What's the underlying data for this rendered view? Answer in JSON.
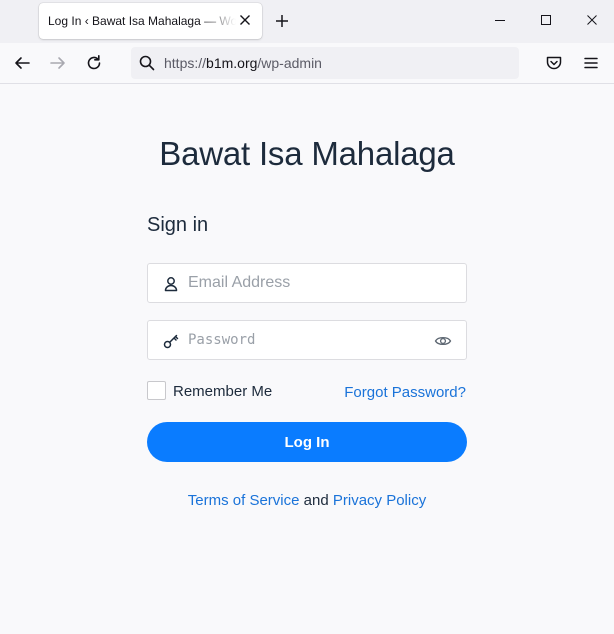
{
  "browser": {
    "tab_title": "Log In ‹ Bawat Isa Mahalaga — WordPress",
    "url_scheme": "https://",
    "url_host": "b1m.org",
    "url_path": "/wp-admin"
  },
  "page": {
    "site_title": "Bawat Isa Mahalaga",
    "heading": "Sign in",
    "email_placeholder": "Email Address",
    "password_placeholder": "Password",
    "remember_label": "Remember Me",
    "forgot_label": "Forgot Password?",
    "login_label": "Log In",
    "terms_label": "Terms of Service",
    "and_text": "and",
    "privacy_label": "Privacy Policy"
  },
  "colors": {
    "accent": "#0a7cff",
    "link": "#1a73d9",
    "text": "#1d2b3c"
  }
}
